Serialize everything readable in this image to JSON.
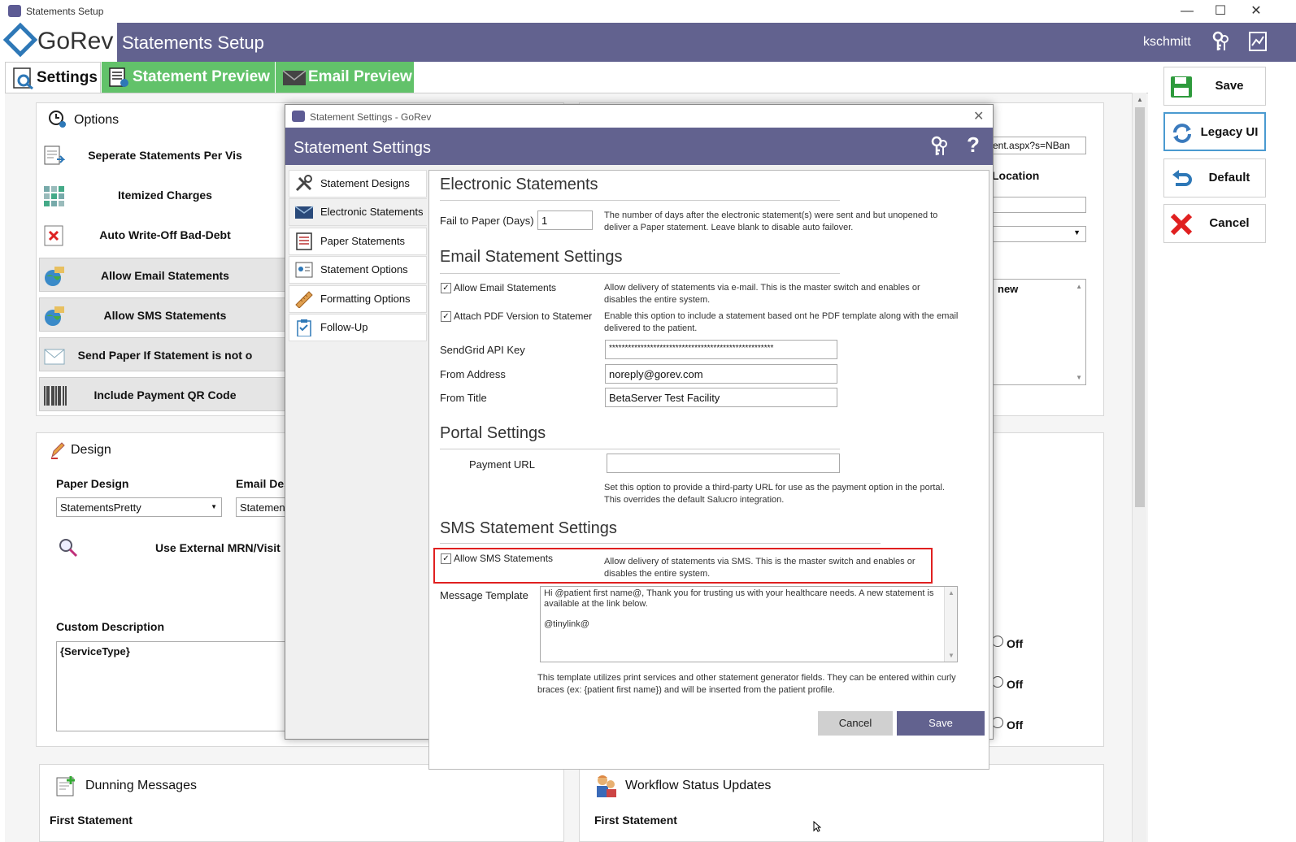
{
  "window": {
    "title": "Statements Setup"
  },
  "header": {
    "logo": "GoRev",
    "title": "Statements Setup",
    "user": "kschmitt",
    "icons": [
      "keys-icon",
      "chart-icon"
    ]
  },
  "tabs": [
    {
      "label": "Settings",
      "icon": "settings-icon"
    },
    {
      "label": "Statement Preview",
      "icon": "preview-icon"
    },
    {
      "label": "Email Preview",
      "icon": "envelope-icon"
    }
  ],
  "options": {
    "title": "Options",
    "rows": [
      "Seperate Statements Per Vis",
      "Itemized Charges",
      "Auto Write-Off Bad-Debt",
      "Allow Email Statements",
      "Allow SMS Statements",
      "Send Paper If Statement is not o",
      "Include Payment QR Code"
    ]
  },
  "design": {
    "title": "Design",
    "paper_label": "Paper Design",
    "paper_value": "StatementsPretty",
    "email_label": "Email Des",
    "email_value": "Statemen",
    "external": "Use External MRN/Visit",
    "custom_label": "Custom Description",
    "custom_value": "{ServiceType}"
  },
  "right_panel": {
    "url": "ent.aspx?s=NBan",
    "location_label": "Location",
    "textarea_fragment": "new",
    "off_labels": [
      "Off",
      "Off",
      "Off"
    ]
  },
  "dunning": {
    "title": "Dunning Messages",
    "first": "First Statement"
  },
  "workflow": {
    "title": "Workflow Status Updates",
    "first": "First Statement"
  },
  "side_buttons": {
    "save": "Save",
    "legacy": "Legacy UI",
    "default": "Default",
    "cancel": "Cancel"
  },
  "dialog": {
    "window_title": "Statement Settings - GoRev",
    "header": "Statement Settings",
    "nav": [
      "Statement Designs",
      "Electronic Statements",
      "Paper Statements",
      "Statement Options",
      "Formatting Options",
      "Follow-Up"
    ],
    "electronic": {
      "title": "Electronic Statements",
      "fail_label": "Fail to Paper (Days)",
      "fail_value": "1",
      "fail_desc": "The number of days after the electronic statement(s) were sent and but unopened to deliver a Paper statement. Leave blank to disable auto failover."
    },
    "email": {
      "title": "Email Statement Settings",
      "allow_label": "Allow Email Statements",
      "allow_desc": "Allow delivery of statements via e-mail. This is the master switch and enables or disables the entire system.",
      "pdf_label": "Attach PDF Version to Statemer",
      "pdf_desc": "Enable this option to include a statement based ont he PDF template along with the email delivered to the patient.",
      "api_label": "SendGrid API Key",
      "api_value": "****************************************************",
      "from_label": "From Address",
      "from_value": "noreply@gorev.com",
      "title_label": "From Title",
      "title_value": "BetaServer Test Facility"
    },
    "portal": {
      "title": "Portal Settings",
      "url_label": "Payment URL",
      "url_value": "",
      "desc": "Set this option to provide a third-party URL for use as the payment option in the portal. This overrides the default Salucro integration."
    },
    "sms": {
      "title": "SMS Statement Settings",
      "allow_label": "Allow SMS Statements",
      "allow_desc": "Allow delivery of statements via SMS. This is the master switch and enables or disables the entire system.",
      "template_label": "Message Template",
      "template_line1": "Hi @patient first name@, Thank you for trusting us with your healthcare needs. A new statement is available at the link below.",
      "template_line2": "@tinylink@",
      "footer": "This template utilizes print services and other statement generator fields. They can be entered within curly braces (ex: {patient first name}) and will be inserted from the patient profile."
    },
    "buttons": {
      "cancel": "Cancel",
      "save": "Save"
    }
  },
  "colors": {
    "header": "#62628f",
    "tab_green": "#62c26a",
    "highlight": "#e02020"
  }
}
